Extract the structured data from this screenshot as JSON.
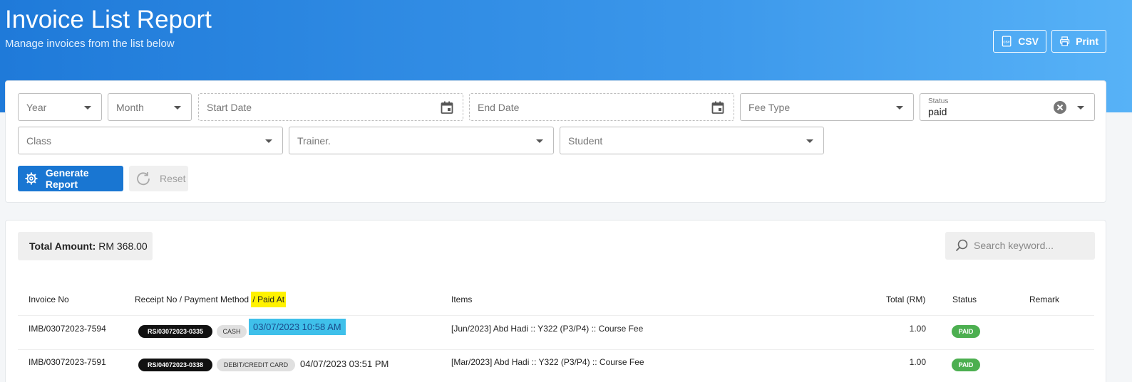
{
  "header": {
    "title": "Invoice List Report",
    "subtitle": "Manage invoices from the list below",
    "csv_label": "CSV",
    "print_label": "Print"
  },
  "filters": {
    "year": "Year",
    "month": "Month",
    "start_date": "Start Date",
    "end_date": "End Date",
    "fee_type": "Fee Type",
    "status_label": "Status",
    "status_value": "paid",
    "class": "Class",
    "trainer": "Trainer.",
    "student": "Student",
    "generate_label": "Generate Report",
    "reset_label": "Reset"
  },
  "summary": {
    "total_label": "Total Amount:",
    "total_value": "RM 368.00",
    "search_placeholder": "Search keyword..."
  },
  "table": {
    "headers": {
      "invoice_no": "Invoice No",
      "receipt_prefix": "Receipt No / Payment Method",
      "receipt_highlight": "/ Paid At",
      "items": "Items",
      "total": "Total (RM)",
      "status": "Status",
      "remark": "Remark"
    },
    "rows": [
      {
        "invoice_no": "IMB/03072023-7594",
        "receipt_no": "RS/03072023-0335",
        "method": "CASH",
        "paid_at": "03/07/2023 10:58 AM",
        "items": "[Jun/2023] Abd Hadi :: Y322 (P3/P4) :: Course Fee",
        "total": "1.00",
        "status": "PAID"
      },
      {
        "invoice_no": "IMB/03072023-7591",
        "receipt_no": "RS/04072023-0338",
        "method": "DEBIT/CREDIT CARD",
        "paid_at": "04/07/2023 03:51 PM",
        "items": "[Mar/2023] Abd Hadi :: Y322 (P3/P4) :: Course Fee",
        "total": "1.00",
        "status": "PAID"
      }
    ]
  },
  "colors": {
    "primary": "#1976d2",
    "paid": "#4caf50",
    "highlight_yellow": "#fff200",
    "highlight_cyan": "#3fc0ea"
  }
}
